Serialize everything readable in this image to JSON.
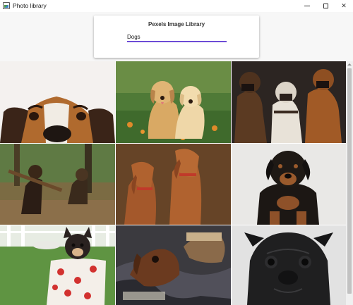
{
  "window": {
    "title": "Photo library",
    "controls": {
      "minimize": "minimize",
      "maximize": "maximize",
      "close": "close"
    }
  },
  "search": {
    "card_title": "Pexels Image Library",
    "value": "Dogs"
  },
  "gallery": {
    "photos": [
      {
        "subject": "beagle-peeking"
      },
      {
        "subject": "golden-puppies"
      },
      {
        "subject": "three-boxers"
      },
      {
        "subject": "dogs-with-stick"
      },
      {
        "subject": "two-vizslas"
      },
      {
        "subject": "rottweiler-puppy"
      },
      {
        "subject": "chihuahua-in-cup"
      },
      {
        "subject": "sleeping-brown-dogs"
      },
      {
        "subject": "black-pug"
      }
    ]
  },
  "colors": {
    "accent": "#6d4cd6"
  }
}
